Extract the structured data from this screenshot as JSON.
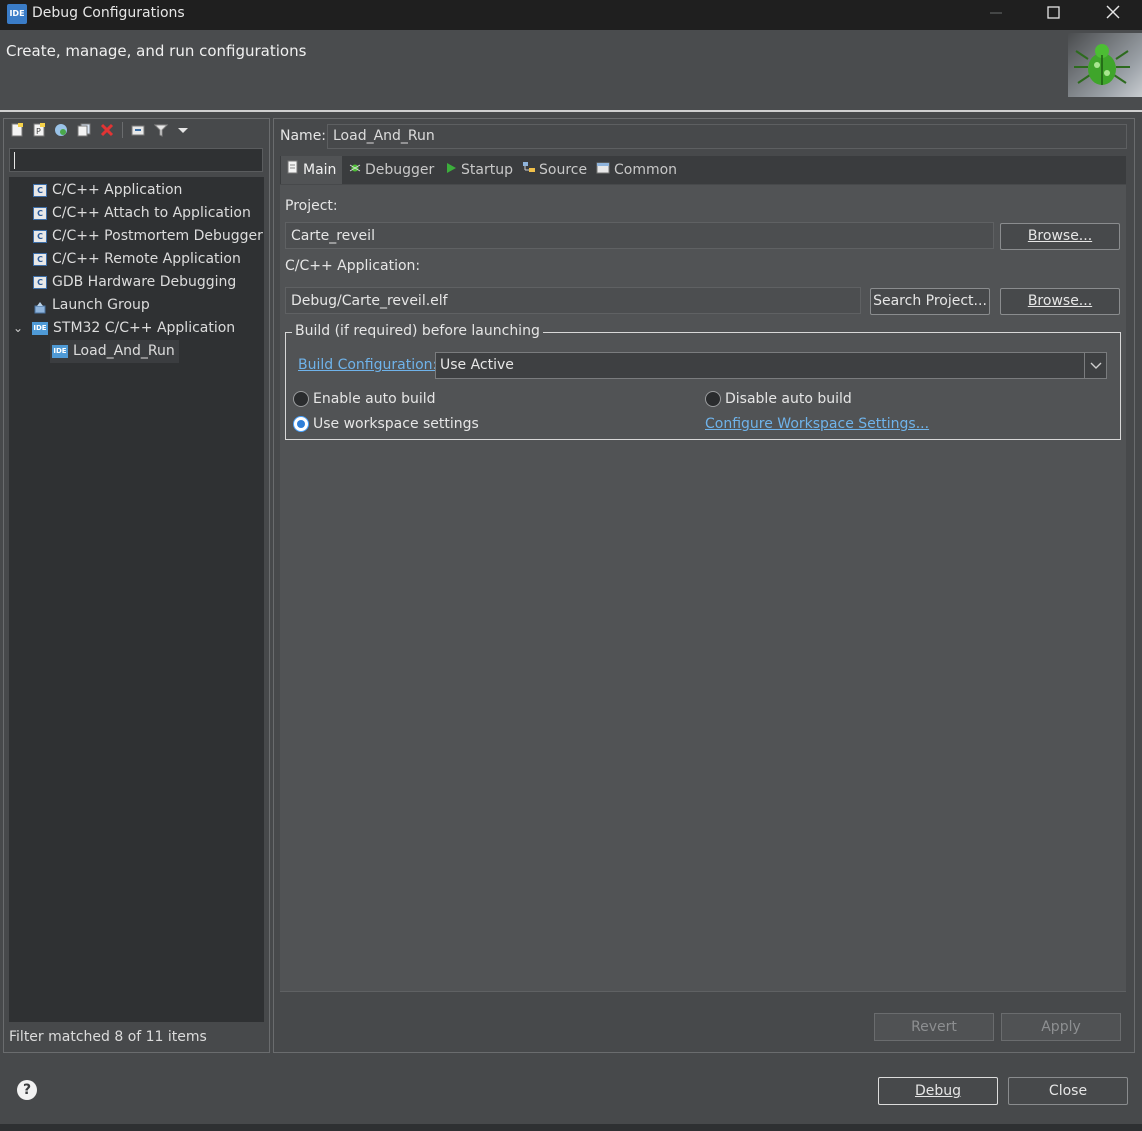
{
  "window": {
    "title": "Debug Configurations",
    "icon_label": "IDE"
  },
  "header": {
    "description": "Create, manage, and run configurations",
    "image": "bug-icon"
  },
  "left_toolbar": {
    "icons": [
      "new-configuration-icon",
      "new-prototype-icon",
      "export-icon",
      "duplicate-icon",
      "delete-icon",
      "collapse-all-icon",
      "filter-icon",
      "dropdown-arrow-icon"
    ]
  },
  "filter": {
    "value": ""
  },
  "tree": {
    "items": [
      {
        "label": "C/C++ Application",
        "icon": "c-icon"
      },
      {
        "label": "C/C++ Attach to Application",
        "icon": "c-icon"
      },
      {
        "label": "C/C++ Postmortem Debugger",
        "icon": "c-icon"
      },
      {
        "label": "C/C++ Remote Application",
        "icon": "c-icon"
      },
      {
        "label": "GDB Hardware Debugging",
        "icon": "c-icon"
      },
      {
        "label": "Launch Group",
        "icon": "launch-group-icon"
      },
      {
        "label": "STM32 C/C++ Application",
        "icon": "ide-icon",
        "expanded": true
      },
      {
        "label": "Load_And_Run",
        "icon": "ide-icon",
        "selected": true
      }
    ],
    "c_badge": "C",
    "ide_badge": "IDE",
    "expand_glyph": "⌄"
  },
  "filter_status": "Filter matched 8 of 11 items",
  "config": {
    "name_label": "Name:",
    "name_value": "Load_And_Run",
    "tabs": [
      {
        "label": "Main",
        "active": true
      },
      {
        "label": "Debugger"
      },
      {
        "label": "Startup"
      },
      {
        "label": "Source"
      },
      {
        "label": "Common"
      }
    ],
    "project_label": "Project:",
    "project_value": "Carte_reveil",
    "project_browse": "Browse...",
    "app_label": "C/C++ Application:",
    "app_value": "Debug/Carte_reveil.elf",
    "search_project": "Search Project...",
    "app_browse": "Browse...",
    "build_group_label": "Build (if required) before launching",
    "build_config_link": "Build Configuration:",
    "build_config_value": "Use Active",
    "radio_enable": "Enable auto build",
    "radio_disable": "Disable auto build",
    "radio_workspace": "Use workspace settings",
    "configure_ws_link": "Configure Workspace Settings...",
    "selected_radio": "Use workspace settings",
    "revert": "Revert",
    "apply": "Apply"
  },
  "footer": {
    "help": "?",
    "debug": "Debug",
    "close": "Close"
  },
  "colors": {
    "accent_link": "#6fb3ea",
    "background": "#47494b",
    "panel_dark": "#2f3133"
  }
}
